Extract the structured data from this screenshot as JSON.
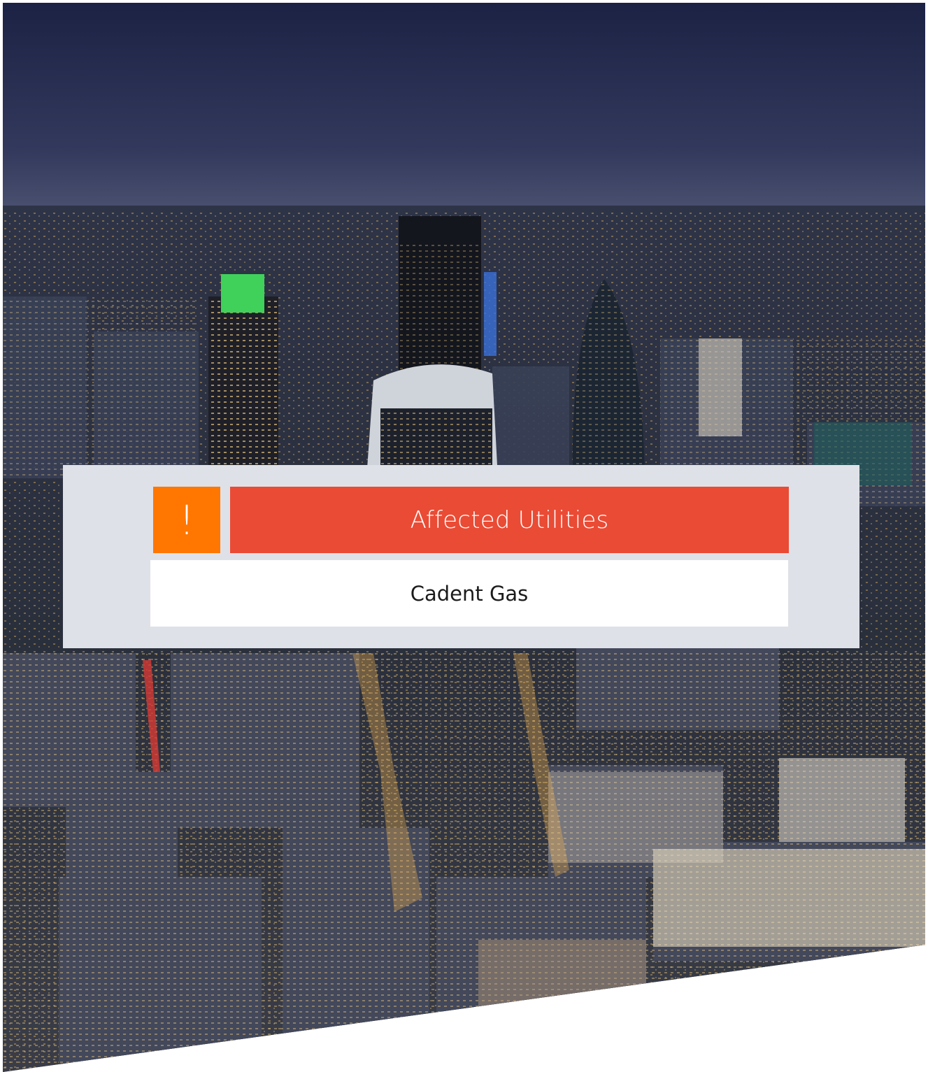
{
  "background": {
    "image": "night city skyline aerial photo",
    "accent_colors": {
      "sky": "#1d2446",
      "city": "#2b3040",
      "lights": "#f2c46a"
    }
  },
  "alert_panel": {
    "icon": "exclamation-icon",
    "icon_glyph": "!",
    "icon_color": "#ff7600",
    "title": "Affected Utilities",
    "title_color": "#ea4b35",
    "items": [
      {
        "label": "Cadent Gas"
      }
    ]
  }
}
